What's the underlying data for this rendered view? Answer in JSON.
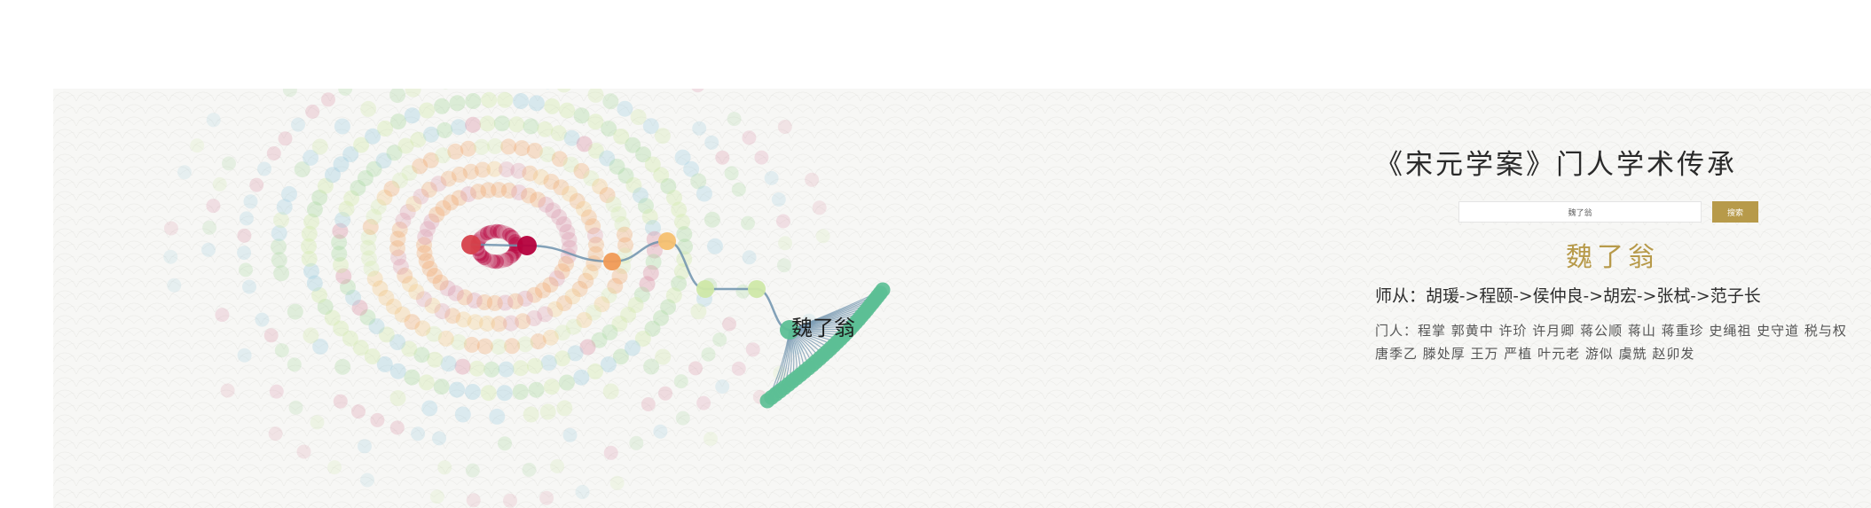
{
  "header": {
    "title": "《宋元学案》门人学术传承"
  },
  "search": {
    "value": "魏了翁",
    "button_label": "搜索"
  },
  "person": {
    "name": "魏了翁",
    "lineage": "师从：胡瑗->程颐->侯仲良->胡宏->张栻->范子长",
    "disciples": "门人：程掌 郭黄中 许玠 许月卿 蒋公顺 蒋山 蒋重珍 史绳祖 史守道 税与权 唐季乙 滕处厚 王万 严植 叶元老 游似 虞兟 赵卯发"
  },
  "graph": {
    "focus_label": "魏了翁",
    "colors": {
      "crimson": "#b5003c",
      "red": "#d6404a",
      "pink": "#d98aa2",
      "orange": "#f09a55",
      "amber": "#f5c070",
      "lightgreen": "#cfe8a8",
      "green": "#a8d8a0",
      "teal": "#5cbf95",
      "skyblue": "#9dcce0",
      "edge": "#6d92ad"
    }
  }
}
